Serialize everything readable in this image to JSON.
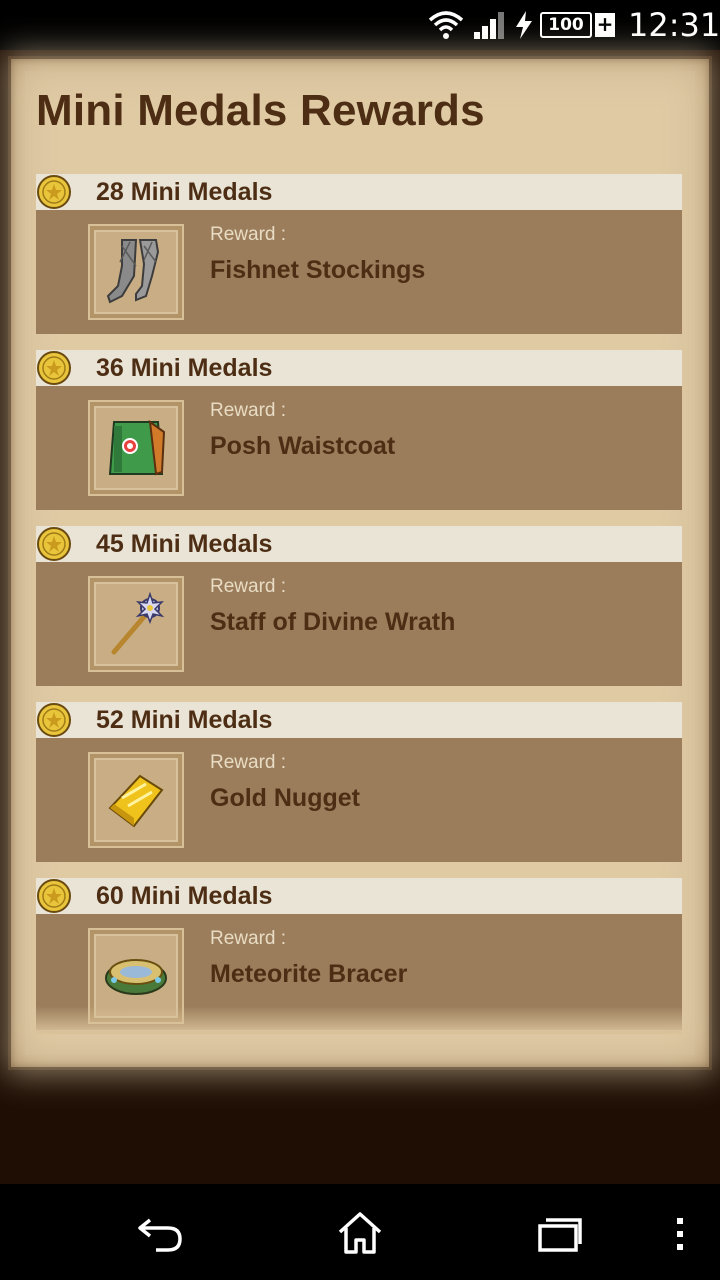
{
  "status_bar": {
    "battery": "100",
    "charging_plus": "+",
    "time": "12:31"
  },
  "page": {
    "title": "Mini Medals Rewards"
  },
  "rewards": [
    {
      "medals": "28 Mini Medals",
      "caption": "Reward :",
      "name": "Fishnet Stockings",
      "icon": "stockings-icon"
    },
    {
      "medals": "36 Mini Medals",
      "caption": "Reward :",
      "name": "Posh Waistcoat",
      "icon": "waistcoat-icon"
    },
    {
      "medals": "45 Mini Medals",
      "caption": "Reward :",
      "name": "Staff of Divine Wrath",
      "icon": "staff-icon"
    },
    {
      "medals": "52 Mini Medals",
      "caption": "Reward :",
      "name": "Gold Nugget",
      "icon": "gold-nugget-icon"
    },
    {
      "medals": "60 Mini Medals",
      "caption": "Reward :",
      "name": "Meteorite Bracer",
      "icon": "bracer-icon"
    }
  ],
  "colors": {
    "parchment": "#dcc49c",
    "title_text": "#4d2e14",
    "medal_bar": "#e9e4d6",
    "reward_body": "#9b7d5b",
    "medal_gold": "#e8c53a"
  },
  "nav_bar": {
    "icons": [
      "back-icon",
      "home-icon",
      "recents-icon",
      "menu-icon"
    ]
  }
}
